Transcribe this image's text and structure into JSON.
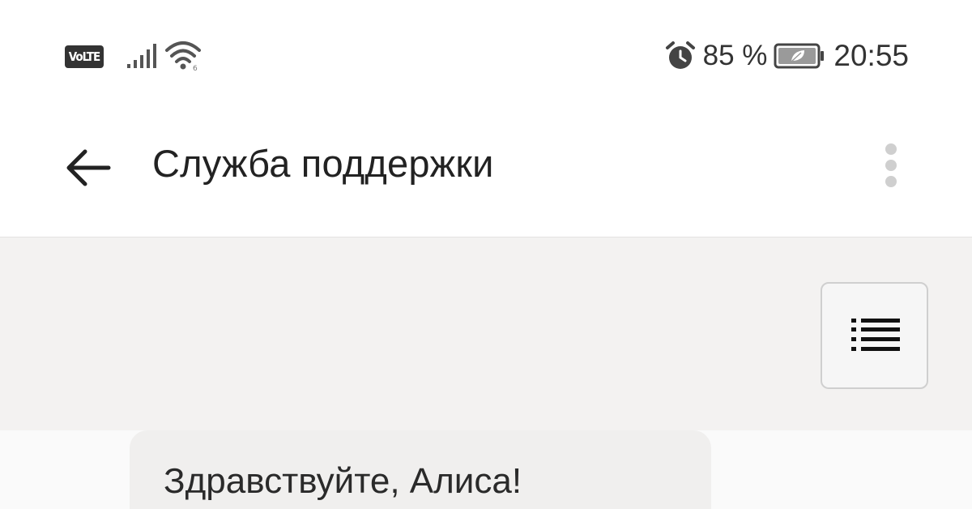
{
  "status_bar": {
    "network_badge": "VoLTE",
    "battery_percent": "85 %",
    "time": "20:55",
    "icons": [
      "volte-icon",
      "signal-icon",
      "wifi-icon",
      "alarm-icon",
      "battery-icon"
    ]
  },
  "header": {
    "title": "Служба поддержки",
    "back_icon": "back-arrow-icon",
    "menu_icon": "more-vertical-icon"
  },
  "chat": {
    "list_button_icon": "list-icon",
    "messages": [
      {
        "text": "Здравствуйте, Алиса!"
      }
    ]
  },
  "colors": {
    "chat_background": "#f3f2f1",
    "bubble": "#f0efee",
    "text": "#222222"
  }
}
